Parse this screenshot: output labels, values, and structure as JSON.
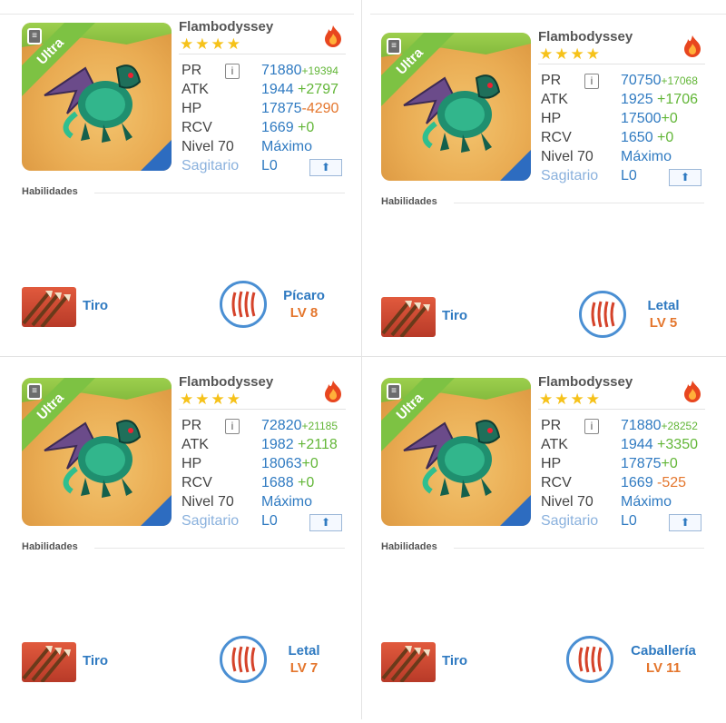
{
  "panels": [
    {
      "name": "Flambodyssey",
      "stars": "★★★★",
      "ribbon": "Ultra",
      "stats": {
        "pr_label": "PR",
        "pr": "71880",
        "pr_bonus": "+19394",
        "atk_label": "ATK",
        "atk": "1944",
        "atk_bonus": "+2797",
        "hp_label": "HP",
        "hp": "17875",
        "hp_bonus": "-4290",
        "rcv_label": "RCV",
        "rcv": "1669",
        "rcv_bonus": "+0",
        "level_label": "Nivel 70",
        "level_value": "Máximo",
        "sign_label": "Sagitario",
        "sign_value": "L0"
      },
      "abilities_label": "Habilidades",
      "skill": "Tiro",
      "awakening": "Pícaro",
      "awakening_level": "LV 8"
    },
    {
      "name": "Flambodyssey",
      "stars": "★★★★",
      "ribbon": "Ultra",
      "stats": {
        "pr_label": "PR",
        "pr": "70750",
        "pr_bonus": "+17068",
        "atk_label": "ATK",
        "atk": "1925",
        "atk_bonus": "+1706",
        "hp_label": "HP",
        "hp": "17500",
        "hp_bonus": "+0",
        "rcv_label": "RCV",
        "rcv": "1650",
        "rcv_bonus": "+0",
        "level_label": "Nivel 70",
        "level_value": "Máximo",
        "sign_label": "Sagitario",
        "sign_value": "L0"
      },
      "abilities_label": "Habilidades",
      "skill": "Tiro",
      "awakening": "Letal",
      "awakening_level": "LV 5"
    },
    {
      "name": "Flambodyssey",
      "stars": "★★★★",
      "ribbon": "Ultra",
      "stats": {
        "pr_label": "PR",
        "pr": "72820",
        "pr_bonus": "+21185",
        "atk_label": "ATK",
        "atk": "1982",
        "atk_bonus": "+2118",
        "hp_label": "HP",
        "hp": "18063",
        "hp_bonus": "+0",
        "rcv_label": "RCV",
        "rcv": "1688",
        "rcv_bonus": "+0",
        "level_label": "Nivel 70",
        "level_value": "Máximo",
        "sign_label": "Sagitario",
        "sign_value": "L0"
      },
      "abilities_label": "Habilidades",
      "skill": "Tiro",
      "awakening": "Letal",
      "awakening_level": "LV 7"
    },
    {
      "name": "Flambodyssey",
      "stars": "★★★★",
      "ribbon": "Ultra",
      "stats": {
        "pr_label": "PR",
        "pr": "71880",
        "pr_bonus": "+28252",
        "atk_label": "ATK",
        "atk": "1944",
        "atk_bonus": "+3350",
        "hp_label": "HP",
        "hp": "17875",
        "hp_bonus": "+0",
        "rcv_label": "RCV",
        "rcv": "1669",
        "rcv_bonus": "-525",
        "level_label": "Nivel 70",
        "level_value": "Máximo",
        "sign_label": "Sagitario",
        "sign_value": "L0"
      },
      "abilities_label": "Habilidades",
      "skill": "Tiro",
      "awakening": "Caballería",
      "awakening_level": "LV 11"
    }
  ]
}
